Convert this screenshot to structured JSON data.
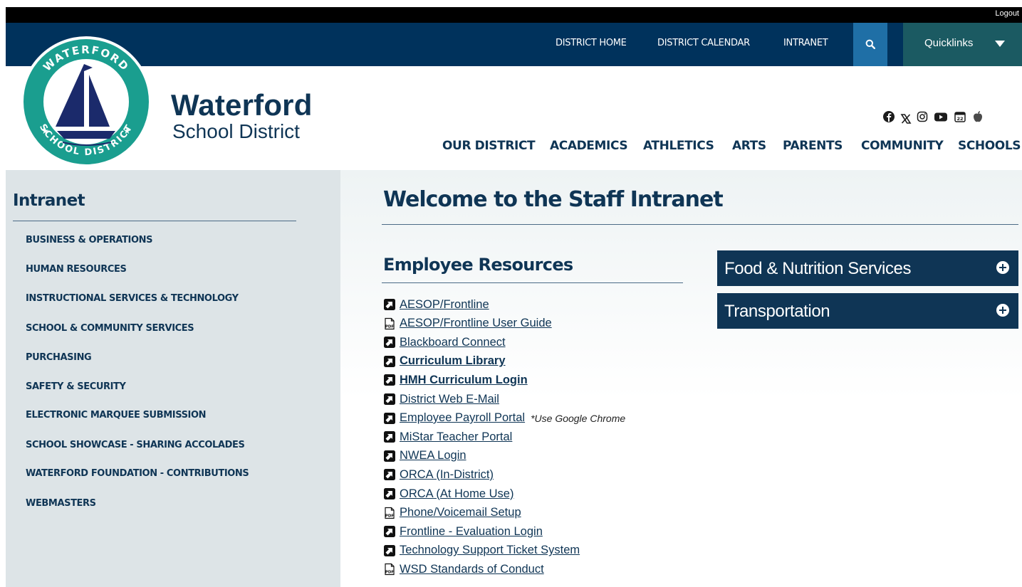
{
  "top": {
    "logout": "Logout"
  },
  "utility_nav": {
    "items": [
      "DISTRICT HOME",
      "DISTRICT CALENDAR",
      "INTRANET"
    ],
    "search_icon": "search-icon",
    "quicklinks": "Quicklinks"
  },
  "brand": {
    "name": "Waterford",
    "subtitle": "School District",
    "logo_top_text": "WATERFORD",
    "logo_bottom_text": "SCHOOL DISTRICT",
    "logo_colors": {
      "ring": "#1a9e8f",
      "navy": "#1b2a6b"
    }
  },
  "social_icons": [
    "facebook-icon",
    "x-icon",
    "instagram-icon",
    "youtube-icon",
    "calendar-icon",
    "apple-icon"
  ],
  "main_nav": [
    "OUR DISTRICT",
    "ACADEMICS",
    "ATHLETICS",
    "ARTS",
    "PARENTS",
    "COMMUNITY",
    "SCHOOLS"
  ],
  "sidebar": {
    "title": "Intranet",
    "items": [
      "BUSINESS & OPERATIONS",
      "HUMAN RESOURCES",
      "INSTRUCTIONAL SERVICES & TECHNOLOGY",
      "SCHOOL & COMMUNITY SERVICES",
      "PURCHASING",
      "SAFETY & SECURITY",
      "ELECTRONIC MARQUEE SUBMISSION",
      "SCHOOL SHOWCASE - SHARING ACCOLADES",
      "WATERFORD FOUNDATION - CONTRIBUTIONS",
      "WEBMASTERS"
    ]
  },
  "main": {
    "title": "Welcome to the Staff Intranet",
    "section_title": "Employee Resources",
    "resources": [
      {
        "label": "AESOP/Frontline",
        "icon": "external-link-icon",
        "bold": false
      },
      {
        "label": "AESOP/Frontline User Guide",
        "icon": "pdf-icon",
        "bold": false
      },
      {
        "label": "Blackboard Connect",
        "icon": "external-link-icon",
        "bold": false
      },
      {
        "label": "Curriculum Library",
        "icon": "external-link-icon",
        "bold": true
      },
      {
        "label": "HMH Curriculum Login",
        "icon": "external-link-icon",
        "bold": true
      },
      {
        "label": "District Web E-Mail",
        "icon": "external-link-icon",
        "bold": false
      },
      {
        "label": "Employee Payroll Portal",
        "icon": "external-link-icon",
        "bold": false,
        "note": "*Use Google Chrome"
      },
      {
        "label": "MiStar Teacher Portal",
        "icon": "external-link-icon",
        "bold": false
      },
      {
        "label": "NWEA Login",
        "icon": "external-link-icon",
        "bold": false
      },
      {
        "label": "ORCA (In-District)",
        "icon": "external-link-icon",
        "bold": false
      },
      {
        "label": "ORCA (At Home Use)",
        "icon": "external-link-icon",
        "bold": false
      },
      {
        "label": "Phone/Voicemail Setup",
        "icon": "pdf-icon",
        "bold": false
      },
      {
        "label": "Frontline - Evaluation Login",
        "icon": "external-link-icon",
        "bold": false
      },
      {
        "label": "Technology Support Ticket System",
        "icon": "external-link-icon",
        "bold": false
      },
      {
        "label": "WSD Standards of Conduct",
        "icon": "pdf-icon",
        "bold": false
      }
    ],
    "accordions": [
      "Food & Nutrition Services",
      "Transportation"
    ]
  },
  "colors": {
    "navy": "#00325c",
    "dark_navy": "#0f3555",
    "search_blue": "#1f6fa6",
    "quicklinks_teal": "#1b5a62",
    "sidebar_bg": "#dde4e7"
  }
}
